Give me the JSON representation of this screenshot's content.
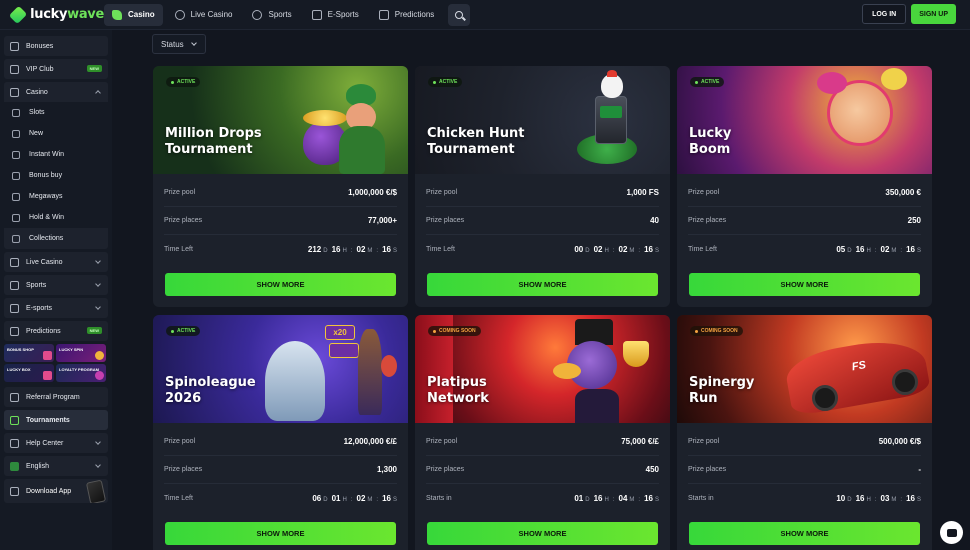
{
  "brand": {
    "name_part1": "lucky",
    "name_part2": "wave"
  },
  "topnav": {
    "items": [
      {
        "label": "Casino",
        "icon": "spade-icon",
        "active": true
      },
      {
        "label": "Live Casino",
        "icon": "dealer-icon"
      },
      {
        "label": "Sports",
        "icon": "ball-icon"
      },
      {
        "label": "E-Sports",
        "icon": "gamepad-icon"
      },
      {
        "label": "Predictions",
        "icon": "chart-icon"
      }
    ],
    "login_label": "LOG IN",
    "signup_label": "SIGN UP"
  },
  "sidebar": {
    "bonuses": "Bonuses",
    "vip_club": "VIP Club",
    "vip_badge": "NEW",
    "casino": "Casino",
    "casino_sub": [
      "Slots",
      "New",
      "Instant Win",
      "Bonus buy",
      "Megaways",
      "Hold & Win",
      "Collections"
    ],
    "live_casino": "Live Casino",
    "sports": "Sports",
    "esports": "E-sports",
    "predictions": "Predictions",
    "predictions_badge": "NEW",
    "promos": [
      "BONUS SHOP",
      "LUCKY SPIN",
      "LUCKY BOX",
      "LOYALTY PROGRAM"
    ],
    "referral": "Referral Program",
    "tournaments": "Tournaments",
    "help": "Help Center",
    "language": "English",
    "download": "Download App"
  },
  "filter": {
    "status_label": "Status"
  },
  "tournaments": [
    {
      "title1": "Million Drops",
      "title2": "Tournament",
      "status": "ACTIVE",
      "prize_pool_label": "Prize pool",
      "prize_pool": "1,000,000 €/$",
      "prize_places_label": "Prize places",
      "prize_places": "77,000+",
      "time_label": "Time Left",
      "d": "212",
      "h": "16",
      "m": "02",
      "s": "16",
      "button": "SHOW MORE"
    },
    {
      "title1": "Chicken Hunt",
      "title2": "Tournament",
      "status": "ACTIVE",
      "prize_pool_label": "Prize pool",
      "prize_pool": "1,000 FS",
      "prize_places_label": "Prize places",
      "prize_places": "40",
      "time_label": "Time Left",
      "d": "00",
      "h": "02",
      "m": "02",
      "s": "16",
      "button": "SHOW MORE"
    },
    {
      "title1": "Lucky",
      "title2": "Boom",
      "status": "ACTIVE",
      "prize_pool_label": "Prize pool",
      "prize_pool": "350,000 €",
      "prize_places_label": "Prize places",
      "prize_places": "250",
      "time_label": "Time Left",
      "d": "05",
      "h": "16",
      "m": "02",
      "s": "16",
      "button": "SHOW MORE"
    },
    {
      "title1": "Spinoleague",
      "title2": "2026",
      "status": "ACTIVE",
      "prize_pool_label": "Prize pool",
      "prize_pool": "12,000,000 €/£",
      "prize_places_label": "Prize places",
      "prize_places": "1,300",
      "time_label": "Time Left",
      "d": "06",
      "h": "01",
      "m": "02",
      "s": "16",
      "button": "SHOW MORE"
    },
    {
      "title1": "Platipus",
      "title2": "Network",
      "status": "COMING SOON",
      "prize_pool_label": "Prize pool",
      "prize_pool": "75,000 €/£",
      "prize_places_label": "Prize places",
      "prize_places": "450",
      "time_label": "Starts in",
      "d": "01",
      "h": "16",
      "m": "04",
      "s": "16",
      "button": "SHOW MORE"
    },
    {
      "title1": "Spinergy",
      "title2": "Run",
      "status": "COMING SOON",
      "prize_pool_label": "Prize pool",
      "prize_pool": "500,000 €/$",
      "prize_places_label": "Prize places",
      "prize_places": "-",
      "time_label": "Starts in",
      "d": "10",
      "h": "16",
      "m": "03",
      "s": "16",
      "button": "SHOW MORE"
    }
  ],
  "units": {
    "d": "D",
    "h": "H",
    "m": "M",
    "s": "S",
    "sep": ":"
  },
  "colors": {
    "accent": "#49d63d",
    "bg": "#12161f",
    "card": "#1c212b",
    "soon": "#f4a340"
  }
}
